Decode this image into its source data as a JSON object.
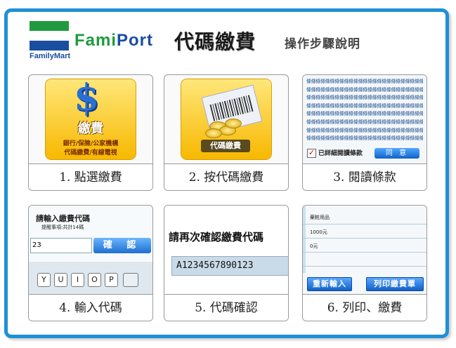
{
  "header": {
    "brand": "FamilyMart",
    "famiport_a": "Fami",
    "famiport_b": "Port",
    "title": "代碼繳費",
    "subtitle": "操作步驟說明"
  },
  "colors": {
    "frame": "#1e90d8",
    "fm_blue": "#1a4ea0",
    "fm_green": "#1f9a3e"
  },
  "steps": [
    {
      "caption": "1. 點選繳費",
      "screen": {
        "big": "繳費",
        "line1": "銀行/保險/公家機構",
        "line2": "代碼繳費/有線電視"
      }
    },
    {
      "caption": "2. 按代碼繳費",
      "screen": {
        "button": "代碼繳費"
      }
    },
    {
      "caption": "3. 閱讀條款",
      "screen": {
        "terms_line": "條條條條條條條條條條條條條條條條條條條條條條條條條條",
        "agree": "已詳細閱讀條款",
        "agree_button": "同 意"
      }
    },
    {
      "caption": "4. 輸入代碼",
      "screen": {
        "title": "請輸入繳費代碼",
        "hint": "提醒事項:共計14碼",
        "value": "23",
        "confirm": "確 認",
        "keys": [
          "Y",
          "U",
          "I",
          "O",
          "P"
        ]
      }
    },
    {
      "caption": "5. 代碼確認",
      "screen": {
        "prompt": "請再次確認繳費代碼",
        "code": "A1234567890123"
      }
    },
    {
      "caption": "6. 列印、繳費",
      "screen": {
        "item": "藥粧用品",
        "amount1": "1000元",
        "amount2": "0元",
        "reenter": "重新輸入",
        "print": "列印繳費單"
      }
    }
  ]
}
